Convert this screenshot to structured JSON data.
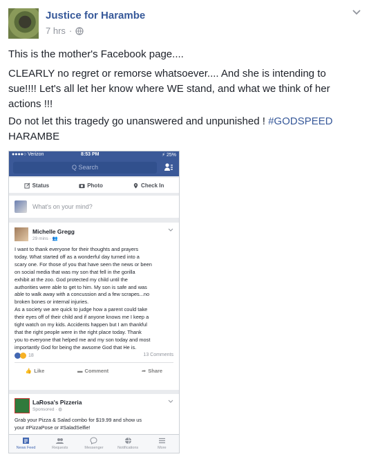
{
  "post": {
    "page_name": "Justice for Harambe",
    "time": "7 hrs",
    "privacy_icon": "globe-icon",
    "menu_icon": "chevron-down-icon",
    "paragraph1": "This is the mother's Facebook page....",
    "paragraph2": "CLEARLY no regret or remorse whatsoever.... And she is intending to sue!!!! Let's all let her know where WE stand, and what we think of her actions !!!",
    "paragraph3_text": "Do not let this tragedy go unanswered and unpunished ! ",
    "paragraph3_hashtag": "#GODSPEED",
    "paragraph3_tail": "HARAMBE",
    "colors": {
      "link": "#365899",
      "fb_blue": "#3b5998",
      "meta": "#90949c"
    }
  },
  "screenshot": {
    "status_left": "●●●●○ Verizon",
    "status_time": "8:53 PM",
    "status_right": "⚡ 25%",
    "search_placeholder": "Q Search",
    "actions": {
      "status": "Status",
      "photo": "Photo",
      "checkin": "Check In"
    },
    "composer_placeholder": "What's on your mind?",
    "post": {
      "author": "Michelle Gregg",
      "time": "29 mins · ",
      "body_lines": [
        "I want to thank everyone for their thoughts and prayers",
        "today. What started off as a wonderful day turned into a",
        "scary one. For those of you that have seen the news or been",
        "on social media that was my son that fell in the gorilla",
        "exhibit at the zoo. God protected my child until the",
        "authorities were able to get to him. My son is safe and was",
        "able to walk away with a concussion and a few scrapes...no",
        "broken bones or internal injuries.",
        "As a society we are quick to judge how a parent could take",
        "their eyes off of their child and if anyone knows me I keep a",
        "tight watch on my kids. Accidents happen but I am thankful",
        "that the right people were in the right place today. Thank",
        "you to everyone that helped me and my son today and most",
        "importantly God for being the awsome God that He is."
      ],
      "reactions_count": "18",
      "comments": "13 Comments",
      "like": "Like",
      "comment": "Comment",
      "share": "Share"
    },
    "ad": {
      "name": "LaRosa's Pizzeria",
      "sponsored": "Sponsored · ",
      "line1": "Grab your Pizza & Salad combo for $19.99 and show us",
      "line2": "your #PizzaPose or #SaladSelfie!"
    },
    "tabs": [
      "News Feed",
      "Requests",
      "Messenger",
      "Notifications",
      "More"
    ]
  }
}
